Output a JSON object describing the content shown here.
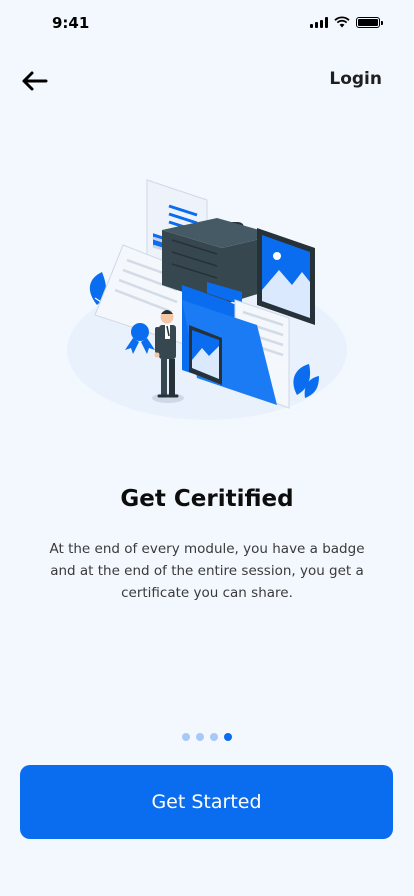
{
  "status_bar": {
    "time": "9:41"
  },
  "header": {
    "back_icon": "arrow-left-icon",
    "login_label": "Login"
  },
  "onboarding": {
    "title": "Get Ceritified",
    "description": "At the end of every module, you have a badge and at the end of the entire session, you get a certificate you can share.",
    "pager": {
      "total": 4,
      "active_index": 3
    }
  },
  "cta": {
    "label": "Get Started"
  },
  "colors": {
    "background": "#f3f8ff",
    "primary": "#0a6df0",
    "dot_inactive": "#a8c9f7",
    "illustration_dark": "#37474f"
  }
}
